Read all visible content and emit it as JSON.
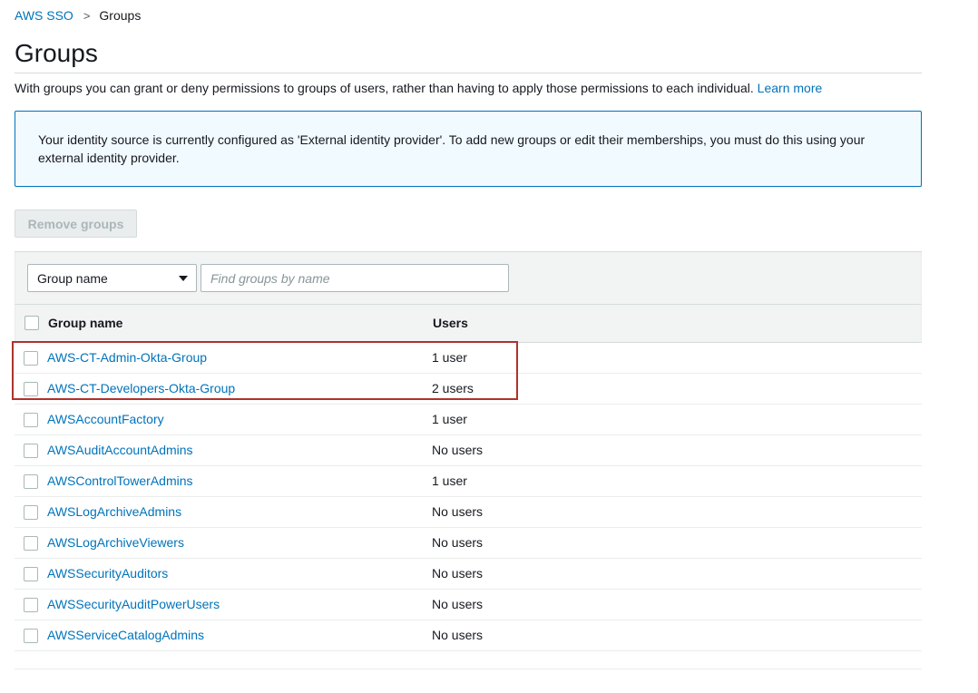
{
  "breadcrumb": {
    "root": "AWS SSO",
    "separator": ">",
    "current": "Groups"
  },
  "page": {
    "title": "Groups",
    "description": "With groups you can grant or deny permissions to groups of users, rather than having to apply those permissions to each individual.",
    "learn_more": "Learn more"
  },
  "info_box": {
    "message": "Your identity source is currently configured as 'External identity provider'. To add new groups or edit their memberships, you must do this using your external identity provider."
  },
  "toolbar": {
    "remove_label": "Remove groups"
  },
  "filter": {
    "select_value": "Group name",
    "search_placeholder": "Find groups by name"
  },
  "table": {
    "columns": [
      "Group name",
      "Users"
    ],
    "rows": [
      {
        "name": "AWS-CT-Admin-Okta-Group",
        "users": "1 user"
      },
      {
        "name": "AWS-CT-Developers-Okta-Group",
        "users": "2 users"
      },
      {
        "name": "AWSAccountFactory",
        "users": "1 user"
      },
      {
        "name": "AWSAuditAccountAdmins",
        "users": "No users"
      },
      {
        "name": "AWSControlTowerAdmins",
        "users": "1 user"
      },
      {
        "name": "AWSLogArchiveAdmins",
        "users": "No users"
      },
      {
        "name": "AWSLogArchiveViewers",
        "users": "No users"
      },
      {
        "name": "AWSSecurityAuditors",
        "users": "No users"
      },
      {
        "name": "AWSSecurityAuditPowerUsers",
        "users": "No users"
      },
      {
        "name": "AWSServiceCatalogAdmins",
        "users": "No users"
      }
    ]
  },
  "colors": {
    "link": "#0073bb",
    "info_border": "#0073bb",
    "info_bg": "#f1faff",
    "highlight": "#b0312b"
  }
}
